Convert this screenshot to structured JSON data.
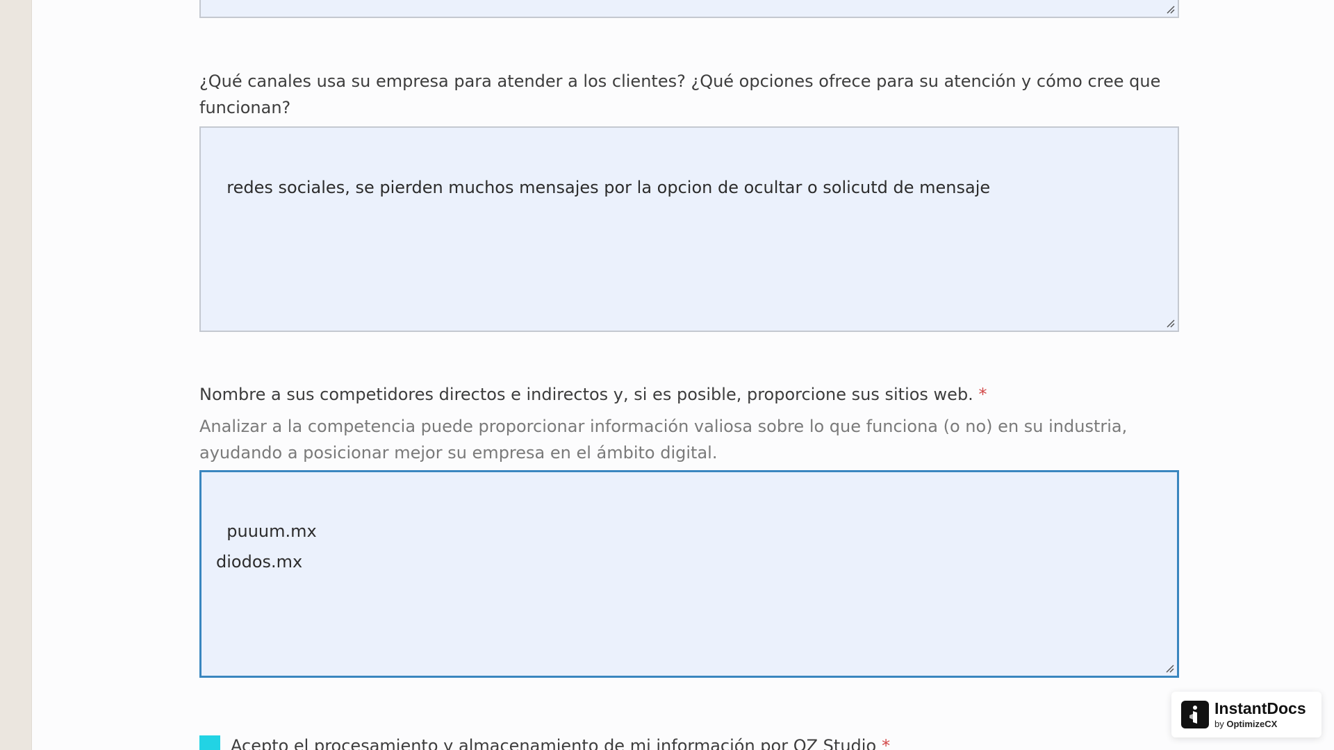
{
  "form": {
    "q_channels": {
      "label": "¿Qué canales usa su empresa para atender a los clientes? ¿Qué opciones ofrece para su atención y cómo cree que funcionan?",
      "value": "redes sociales, se pierden muchos mensajes por la opcion de ocultar o solicutd de mensaje"
    },
    "q_competitors": {
      "label": "Nombre a sus competidores directos e indirectos y, si es posible, proporcione sus sitios web.",
      "required_mark": "*",
      "help": "Analizar a la competencia puede proporcionar información valiosa sobre lo que funciona (o no) en su industria, ayudando a posicionar mejor su empresa en el ámbito digital.",
      "value": "puuum.mx\ndiodos.mx"
    },
    "consent": {
      "label": "Acepto el procesamiento y almacenamiento de mi información por OZ Studio",
      "required_mark": "*"
    }
  },
  "badge": {
    "title": "InstantDocs",
    "by": "by",
    "brand": "OptimizeCX"
  },
  "colors": {
    "checkbox": "#22d3e4",
    "focus_border": "#3a86bf",
    "required": "#d24848",
    "field_bg": "#ebf1fc"
  },
  "icons": {
    "resize": "resize-handle-icon",
    "badge_logo": "instantdocs-logo-icon"
  }
}
